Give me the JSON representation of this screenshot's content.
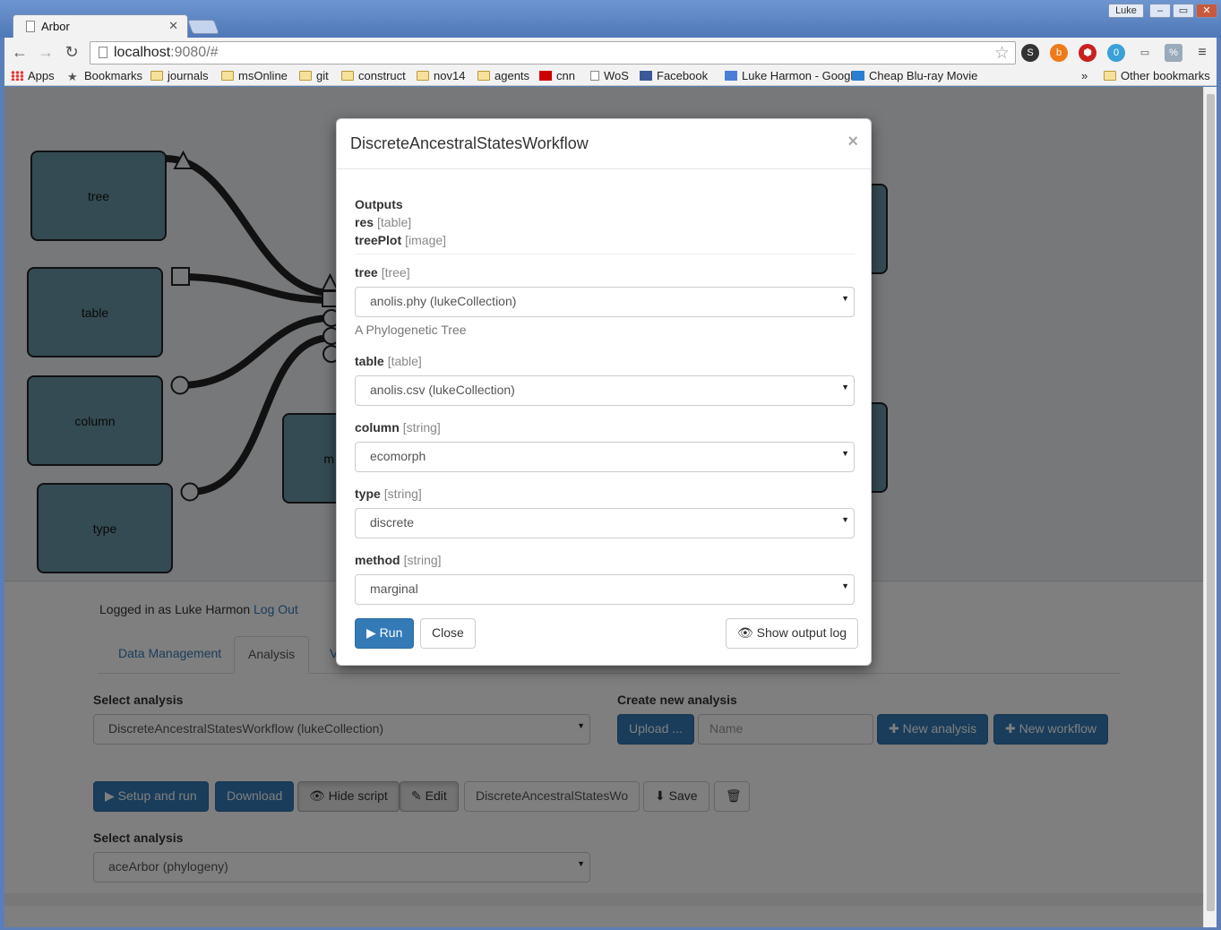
{
  "browser": {
    "tab_title": "Arbor",
    "profile_name": "Luke",
    "url_host": "localhost",
    "url_rest": ":9080/#",
    "extension_badge": "0"
  },
  "bookmarks": [
    {
      "label": "Apps",
      "icon": "apps-icon"
    },
    {
      "label": "Bookmarks",
      "icon": "star-icon"
    },
    {
      "label": "journals",
      "icon": "folder-icon"
    },
    {
      "label": "msOnline",
      "icon": "folder-icon"
    },
    {
      "label": "git",
      "icon": "folder-icon"
    },
    {
      "label": "construct",
      "icon": "folder-icon"
    },
    {
      "label": "nov14",
      "icon": "folder-icon"
    },
    {
      "label": "agents",
      "icon": "folder-icon"
    },
    {
      "label": "cnn",
      "icon": "cnn-icon"
    },
    {
      "label": "WoS",
      "icon": "page-icon"
    },
    {
      "label": "Facebook",
      "icon": "facebook-icon"
    },
    {
      "label": "Luke Harmon - Googl",
      "icon": "scholar-icon"
    },
    {
      "label": "Cheap Blu-ray Movie",
      "icon": "blog-icon"
    }
  ],
  "bookmarks_overflow": "»",
  "other_bookmarks": "Other bookmarks",
  "workflow": {
    "nodes": {
      "tree": "tree",
      "table": "table",
      "column": "column",
      "type": "type",
      "partial": "m"
    }
  },
  "page": {
    "logged_in_text": "Logged in as Luke Harmon",
    "logout_label": "Log Out",
    "tabs": [
      "Data Management",
      "Analysis",
      "Vi"
    ],
    "select_analysis_label": "Select analysis",
    "selected_analysis": "DiscreteAncestralStatesWorkflow (lukeCollection)",
    "create_new_label": "Create new analysis",
    "upload_label": "Upload ...",
    "name_placeholder": "Name",
    "new_analysis_label": "New analysis",
    "new_workflow_label": "New workflow",
    "setup_run_label": "Setup and run",
    "download_label": "Download",
    "hide_script_label": "Hide script",
    "edit_label": "Edit",
    "analysis_name_value": "DiscreteAncestralStatesWo",
    "save_label": "Save",
    "select_analysis_label_2": "Select analysis",
    "selected_analysis_2": "aceArbor (phylogeny)"
  },
  "modal": {
    "title": "DiscreteAncestralStatesWorkflow",
    "close_glyph": "×",
    "outputs_label": "Outputs",
    "outputs": [
      {
        "name": "res",
        "type": "[table]"
      },
      {
        "name": "treePlot",
        "type": "[image]"
      }
    ],
    "inputs": [
      {
        "name": "tree",
        "type": "[tree]",
        "value": "anolis.phy (lukeCollection)",
        "help": "A Phylogenetic Tree"
      },
      {
        "name": "table",
        "type": "[table]",
        "value": "anolis.csv (lukeCollection)"
      },
      {
        "name": "column",
        "type": "[string]",
        "value": "ecomorph"
      },
      {
        "name": "type",
        "type": "[string]",
        "value": "discrete"
      },
      {
        "name": "method",
        "type": "[string]",
        "value": "marginal"
      }
    ],
    "run_label": "Run",
    "close_label": "Close",
    "show_log_label": "Show output log"
  }
}
